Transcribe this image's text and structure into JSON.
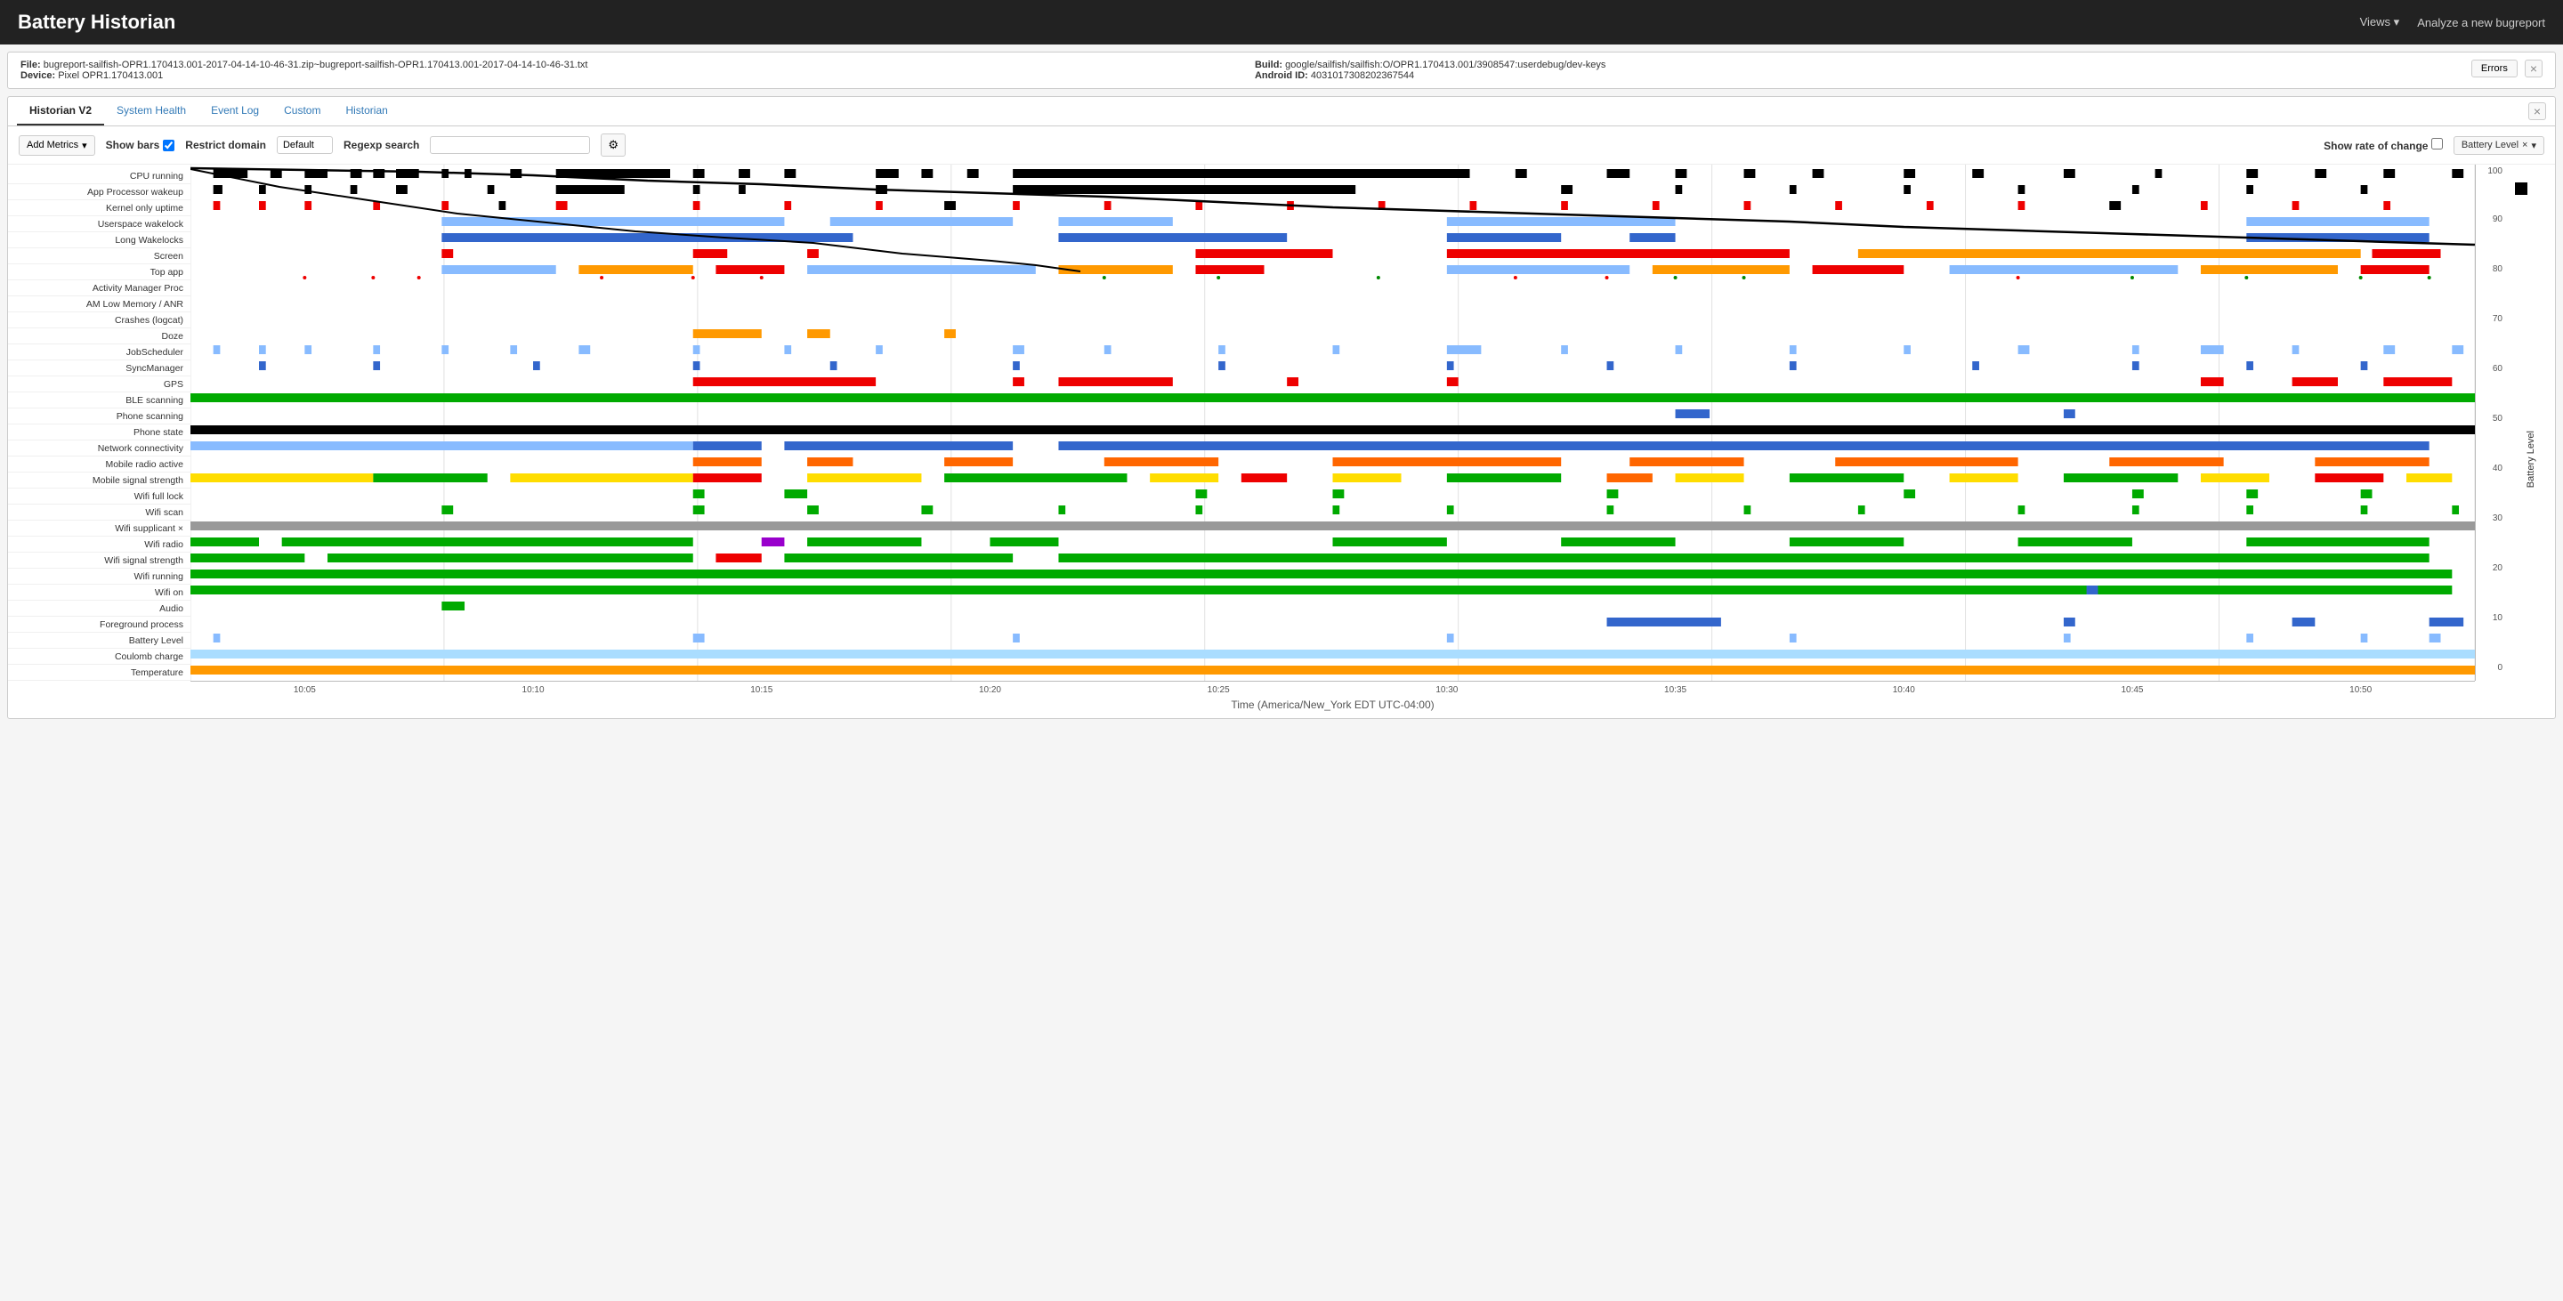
{
  "header": {
    "title": "Battery Historian",
    "nav": [
      {
        "label": "Views ▾",
        "id": "views-menu"
      },
      {
        "label": "Analyze a new bugreport",
        "id": "analyze-link"
      }
    ]
  },
  "file_info": {
    "file_label": "File:",
    "file_value": "bugreport-sailfish-OPR1.170413.001-2017-04-14-10-46-31.zip~bugreport-sailfish-OPR1.170413.001-2017-04-14-10-46-31.txt",
    "device_label": "Device:",
    "device_value": "Pixel OPR1.170413.001",
    "build_label": "Build:",
    "build_value": "google/sailfish/sailfish:O/OPR1.170413.001/3908547:userdebug/dev-keys",
    "android_id_label": "Android ID:",
    "android_id_value": "4031017308202367544",
    "errors_button": "Errors",
    "close_button": "×"
  },
  "tabs": [
    {
      "label": "Historian V2",
      "active": true
    },
    {
      "label": "System Health",
      "active": false,
      "color": "blue"
    },
    {
      "label": "Event Log",
      "active": false,
      "color": "blue"
    },
    {
      "label": "Custom",
      "active": false,
      "color": "blue"
    },
    {
      "label": "Historian",
      "active": false,
      "color": "blue"
    }
  ],
  "toolbar": {
    "add_metrics_label": "Add Metrics",
    "show_bars_label": "Show bars",
    "restrict_domain_label": "Restrict domain",
    "domain_default": "Default",
    "regexp_label": "Regexp search",
    "regexp_placeholder": "",
    "show_rate_label": "Show rate of change",
    "battery_level_badge": "Battery Level",
    "close_badge": "×"
  },
  "chart": {
    "rows": [
      {
        "label": "CPU running",
        "color": "#000"
      },
      {
        "label": "App Processor wakeup",
        "color": "#000"
      },
      {
        "label": "Kernel only uptime",
        "color": "#f00"
      },
      {
        "label": "Userspace wakelock",
        "color": "#6cf"
      },
      {
        "label": "Long Wakelocks",
        "color": "#00f"
      },
      {
        "label": "Screen",
        "color": "#f00"
      },
      {
        "label": "Top app",
        "color": "#f90"
      },
      {
        "label": "Activity Manager Proc",
        "color": "#f00"
      },
      {
        "label": "AM Low Memory / ANR",
        "color": ""
      },
      {
        "label": "Crashes (logcat)",
        "color": ""
      },
      {
        "label": "Doze",
        "color": "#f90"
      },
      {
        "label": "JobScheduler",
        "color": "#6cf"
      },
      {
        "label": "SyncManager",
        "color": "#6cf"
      },
      {
        "label": "GPS",
        "color": "#f00"
      },
      {
        "label": "BLE scanning",
        "color": "#0a0"
      },
      {
        "label": "Phone scanning",
        "color": "#00f"
      },
      {
        "label": "Phone state",
        "color": "#000"
      },
      {
        "label": "Network connectivity",
        "color": "#6cf"
      },
      {
        "label": "Mobile radio active",
        "color": "#f60"
      },
      {
        "label": "Mobile signal strength",
        "color": "#ff0"
      },
      {
        "label": "Wifi full lock",
        "color": "#0a0"
      },
      {
        "label": "Wifi scan",
        "color": "#0a0"
      },
      {
        "label": "Wifi supplicant ×",
        "color": "#999"
      },
      {
        "label": "Wifi radio",
        "color": "#0a0"
      },
      {
        "label": "Wifi signal strength",
        "color": "#0a0"
      },
      {
        "label": "Wifi running",
        "color": "#0a0"
      },
      {
        "label": "Wifi on",
        "color": "#0a0"
      },
      {
        "label": "Audio",
        "color": "#0a0"
      },
      {
        "label": "Foreground process",
        "color": "#00f"
      },
      {
        "label": "Battery Level",
        "color": "#6cf"
      },
      {
        "label": "Coulomb charge",
        "color": "#6cf"
      },
      {
        "label": "Temperature",
        "color": "#f90"
      }
    ],
    "time_labels": [
      "10:05",
      "10:10",
      "10:15",
      "10:20",
      "10:25",
      "10:30",
      "10:35",
      "10:40",
      "10:45",
      "10:50"
    ],
    "time_axis_title": "Time (America/New_York EDT UTC-04:00)",
    "y_ticks": [
      "0",
      "10",
      "20",
      "30",
      "40",
      "50",
      "60",
      "70",
      "80",
      "90",
      "100"
    ],
    "battery_level_axis_label": "Battery Level"
  },
  "colors": {
    "black": "#000000",
    "red": "#e00000",
    "blue": "#3366cc",
    "light_blue": "#88bbff",
    "orange": "#ff9900",
    "green": "#00aa00",
    "yellow": "#ffdd00",
    "gray": "#999999",
    "purple": "#9900cc",
    "teal": "#009999",
    "dark_green": "#006600"
  }
}
